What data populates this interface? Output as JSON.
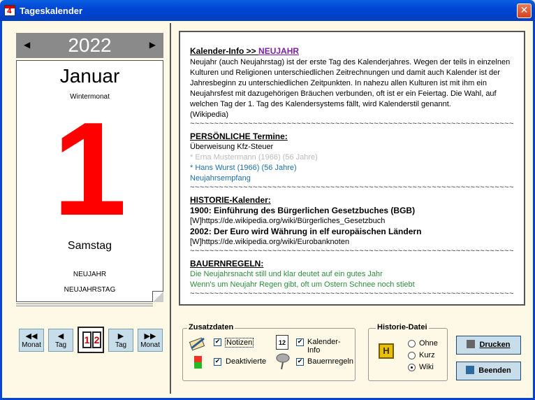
{
  "window": {
    "title": "Tageskalender",
    "close_symbol": "✕"
  },
  "calendar": {
    "year": "2022",
    "month": "Januar",
    "season": "Wintermonat",
    "day": "1",
    "weekday": "Samstag",
    "holidays": [
      "NEUJAHR",
      "NEUJAHRSTAG"
    ]
  },
  "nav": {
    "prev_month": "Monat",
    "prev_day": "Tag",
    "next_day": "Tag",
    "next_month": "Monat",
    "today_digits": [
      "1",
      "2"
    ]
  },
  "info": {
    "kalender_head": "Kalender-Info >> ",
    "kalender_link": "NEUJAHR",
    "kalender_text": "Neujahr (auch Neujahrstag) ist der erste Tag des Kalenderjahres. Wegen der teils in einzelnen Kulturen und Religionen unterschiedlichen Zeitrechnungen und damit auch Kalender ist der Jahresbeginn zu unterschiedlichen Zeitpunkten. In nahezu allen Kulturen ist mit ihm ein Neujahrsfest mit dazugehörigen Bräuchen verbunden, oft ist er ein Feiertag. Die Wahl, auf welchen Tag der 1. Tag des Kalendersystems fällt, wird Kalenderstil genannt.",
    "kalender_source": "(Wikipedia)",
    "separator": "~~~~~~~~~~~~~~~~~~~~~~~~~~~~~~~~~~~~~~~~~~~~~~~~~~~~~~~~~~~~~~~~~~~~~~~~~~~~~~~~",
    "termine_head": "PERSÖNLICHE Termine:",
    "termine": [
      {
        "text": "Überweisung Kfz-Steuer",
        "style": "normal"
      },
      {
        "text": "* Erna Mustermann (1966) (56 Jahre)",
        "style": "grey"
      },
      {
        "text": "* Hans Wurst (1966) (56 Jahre)",
        "style": "blue"
      },
      {
        "text": "Neujahrsempfang",
        "style": "blue"
      }
    ],
    "historie_head": "HISTORIE-Kalender:",
    "historie": [
      {
        "text": "1900: Einführung des Bürgerlichen Gesetzbuches (BGB)",
        "style": "bold"
      },
      {
        "text": "[W]https://de.wikipedia.org/wiki/Bürgerliches_Gesetzbuch",
        "style": "normal"
      },
      {
        "text": "2002: Der Euro wird Währung in elf europäischen Ländern",
        "style": "bold"
      },
      {
        "text": "[W]https://de.wikipedia.org/wiki/Eurobanknoten",
        "style": "normal"
      }
    ],
    "bauern_head": "BAUERNREGELN:",
    "bauern": [
      " Die Neujahrsnacht still und klar deutet auf ein gutes Jahr",
      " Wenn's um Neujahr Regen gibt, oft um Ostern Schnee noch stiebt"
    ]
  },
  "zusatzdaten": {
    "legend": "Zusatzdaten",
    "notizen": {
      "label": "Notizen",
      "checked": true
    },
    "deaktivierte": {
      "label": "Deaktivierte",
      "checked": true
    },
    "kalender_info": {
      "label": "Kalender- Info",
      "checked": true
    },
    "bauernregeln": {
      "label": "Bauernregeln",
      "checked": true
    },
    "cal_icon_day": "12"
  },
  "historie_datei": {
    "legend": "Historie-Datei",
    "options": [
      "Ohne",
      "Kurz",
      "Wiki"
    ],
    "selected": "Wiki",
    "icon_letter": "H"
  },
  "buttons": {
    "drucken": "Drucken",
    "beenden": "Beenden"
  },
  "colors": {
    "title_bar": "#0046d5",
    "day_red": "#ff0000",
    "button_bg": "#c8ddea",
    "window_bg": "#fdf9e6"
  },
  "check_mark": "✔"
}
